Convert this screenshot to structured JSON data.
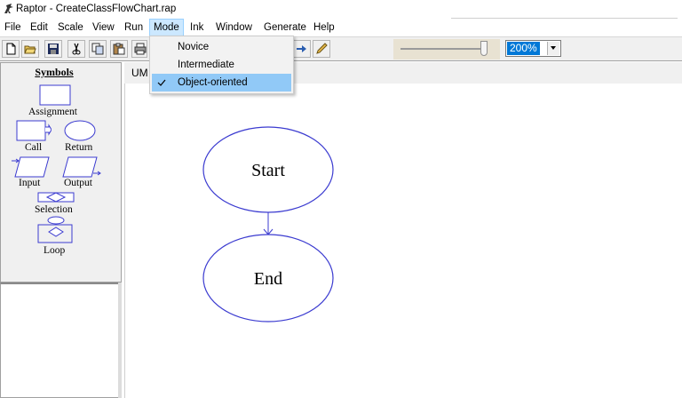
{
  "window": {
    "title": "Raptor - CreateClassFlowChart.rap",
    "app_icon": "raptor-icon"
  },
  "menubar": {
    "items": [
      {
        "label": "File"
      },
      {
        "label": "Edit"
      },
      {
        "label": "Scale"
      },
      {
        "label": "View"
      },
      {
        "label": "Run"
      },
      {
        "label": "Mode",
        "active": true
      },
      {
        "label": "Ink"
      },
      {
        "label": "Window"
      },
      {
        "label": "Generate"
      },
      {
        "label": "Help"
      }
    ]
  },
  "mode_menu": {
    "items": [
      {
        "label": "Novice",
        "checked": false
      },
      {
        "label": "Intermediate",
        "checked": false
      },
      {
        "label": "Object-oriented",
        "checked": true
      }
    ],
    "check_icon": "checkmark-icon"
  },
  "toolbar": {
    "icons": [
      "new-file-icon",
      "open-folder-icon",
      "save-icon",
      "cut-icon",
      "copy-icon",
      "paste-icon",
      "print-icon",
      "run-icon",
      "pen-icon"
    ],
    "zoom_slider_level": 1.0,
    "zoom_value": "200%"
  },
  "symbols_panel": {
    "title": "Symbols",
    "symbols": [
      {
        "label": "Assignment",
        "icon": "assignment-symbol-icon"
      },
      {
        "label": "Call",
        "icon": "call-symbol-icon"
      },
      {
        "label": "Return",
        "icon": "return-symbol-icon"
      },
      {
        "label": "Input",
        "icon": "input-symbol-icon"
      },
      {
        "label": "Output",
        "icon": "output-symbol-icon"
      },
      {
        "label": "Selection",
        "icon": "selection-symbol-icon"
      },
      {
        "label": "Loop",
        "icon": "loop-symbol-icon"
      }
    ]
  },
  "canvas": {
    "tab_label": "UM",
    "nodes": [
      {
        "label": "Start",
        "shape": "ellipse"
      },
      {
        "label": "End",
        "shape": "ellipse"
      }
    ],
    "shape_color": "#3b3bd0"
  }
}
